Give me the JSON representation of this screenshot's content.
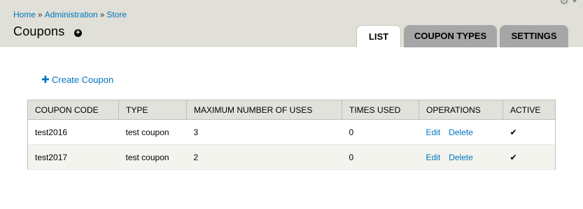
{
  "breadcrumb": {
    "items": [
      "Home",
      "Administration",
      "Store"
    ],
    "separator": "»"
  },
  "page": {
    "title": "Coupons",
    "shortcut_icon": "add-shortcut-icon"
  },
  "toolbar": {
    "gear_icon": "gear-icon"
  },
  "tabs": [
    {
      "label": "LIST",
      "active": true
    },
    {
      "label": "COUPON TYPES",
      "active": false
    },
    {
      "label": "SETTINGS",
      "active": false
    }
  ],
  "actions": {
    "create_label": "Create Coupon",
    "create_icon": "plus-icon"
  },
  "table": {
    "headers": [
      "COUPON CODE",
      "TYPE",
      "MAXIMUM NUMBER OF USES",
      "TIMES USED",
      "OPERATIONS",
      "ACTIVE"
    ],
    "rows": [
      {
        "code": "test2016",
        "type": "test coupon",
        "max_uses": "3",
        "times_used": "0",
        "edit": "Edit",
        "delete": "Delete",
        "active": "✔"
      },
      {
        "code": "test2017",
        "type": "test coupon",
        "max_uses": "2",
        "times_used": "0",
        "edit": "Edit",
        "delete": "Delete",
        "active": "✔"
      }
    ]
  },
  "colors": {
    "link": "#0074bd",
    "header_bg": "#e0e0d8",
    "inactive_tab": "#a6a6a6"
  }
}
